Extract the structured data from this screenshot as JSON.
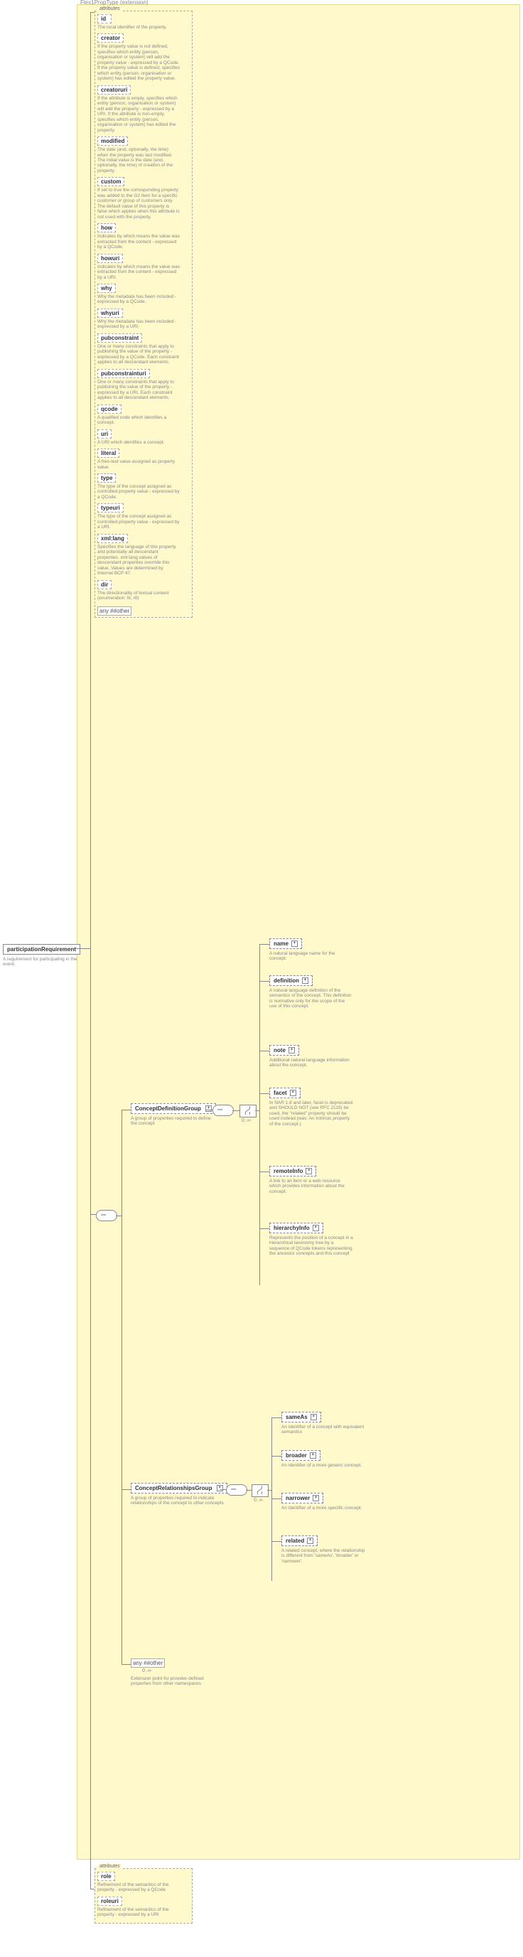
{
  "root": {
    "label": "participationRequirement",
    "desc": "A requirement for participating in the event."
  },
  "ext": {
    "label": "Flex1PropType (extension)"
  },
  "attrs_lbl": "attributes",
  "top_attrs": [
    {
      "n": "id",
      "d": "The local identifier of the property."
    },
    {
      "n": "creator",
      "d": "If the property value is not defined, specifies which entity (person, organisation or system) will add the property value - expressed by a QCode. If the property value is defined, specifies which entity (person, organisation or system) has edited the property value."
    },
    {
      "n": "creatoruri",
      "d": "If the attribute is empty, specifies which entity (person, organisation or system) will add the property - expressed by a URI. If the attribute is non-empty, specifies which entity (person, organisation or system) has edited the property."
    },
    {
      "n": "modified",
      "d": "The date (and, optionally, the time) when the property was last modified. The initial value is the date (and, optionally, the time) of creation of the property."
    },
    {
      "n": "custom",
      "d": "If set to true the corresponding property was added to the G2 Item for a specific customer or group of customers only. The default value of this property is false which applies when this attribute is not used with the property."
    },
    {
      "n": "how",
      "d": "Indicates by which means the value was extracted from the content - expressed by a QCode."
    },
    {
      "n": "howuri",
      "d": "Indicates by which means the value was extracted from the content - expressed by a URI."
    },
    {
      "n": "why",
      "d": "Why the metadata has been included - expressed by a QCode."
    },
    {
      "n": "whyuri",
      "d": "Why the metadata has been included - expressed by a URI."
    },
    {
      "n": "pubconstraint",
      "d": "One or many constraints that apply to publishing the value of the property - expressed by a QCode. Each constraint applies to all descendant elements."
    },
    {
      "n": "pubconstrainturi",
      "d": "One or many constraints that apply to publishing the value of the property - expressed by a URI. Each constraint applies to all descendant elements."
    },
    {
      "n": "qcode",
      "d": "A qualified code which identifies a concept."
    },
    {
      "n": "uri",
      "d": "A URI which identifies a concept."
    },
    {
      "n": "literal",
      "d": "A free-text value assigned as property value."
    },
    {
      "n": "type",
      "d": "The type of the concept assigned as controlled property value - expressed by a QCode."
    },
    {
      "n": "typeuri",
      "d": "The type of the concept assigned as controlled property value - expressed by a URI."
    },
    {
      "n": "xml:lang",
      "d": "Specifies the language of this property and potentially all descendant properties. xml:lang values of descendant properties override this value. Values are determined by Internet BCP 47."
    },
    {
      "n": "dir",
      "d": "The directionality of textual content (enumeration: ltr, rtl)"
    }
  ],
  "top_any": "any ##other",
  "cdg": {
    "label": "ConceptDefinitionGroup",
    "desc": "A group of properties required to define the concept"
  },
  "crg": {
    "label": "ConceptRelationshipsGroup",
    "desc": "A group of properties required to indicate relationships of the concept to other concepts"
  },
  "cdg_children": [
    {
      "n": "name",
      "d": "A natural language name for the concept."
    },
    {
      "n": "definition",
      "d": "A natural language definition of the semantics of the concept. This definition is normative only for the scope of the use of this concept."
    },
    {
      "n": "note",
      "d": "Additional natural language information about the concept."
    },
    {
      "n": "facet",
      "d": "In NAR 1.8 and later, facet is deprecated and SHOULD NOT (see RFC 2119) be used, the \"related\" property should be used instead.(was: An intrinsic property of the concept.)"
    },
    {
      "n": "remoteInfo",
      "d": "A link to an item or a web resource which provides information about the concept."
    },
    {
      "n": "hierarchyInfo",
      "d": "Represents the position of a concept in a hierarchical taxonomy tree by a sequence of QCode tokens representing the ancestor concepts and this concept"
    }
  ],
  "crg_children": [
    {
      "n": "sameAs",
      "d": "An identifier of a concept with equivalent semantics"
    },
    {
      "n": "broader",
      "d": "An identifier of a more generic concept."
    },
    {
      "n": "narrower",
      "d": "An identifier of a more specific concept."
    },
    {
      "n": "related",
      "d": "A related concept, where the relationship is different from 'sameAs', 'broader' or 'narrower'."
    }
  ],
  "body_any": {
    "label": "any ##other",
    "card": "0..∞",
    "desc": "Extension point for provider-defined properties from other namespaces"
  },
  "bot_attrs": [
    {
      "n": "role",
      "d": "Refinement of the semantics of the property - expressed by a QCode"
    },
    {
      "n": "roleuri",
      "d": "Refinement of the semantics of the property - expressed by a URI"
    }
  ]
}
